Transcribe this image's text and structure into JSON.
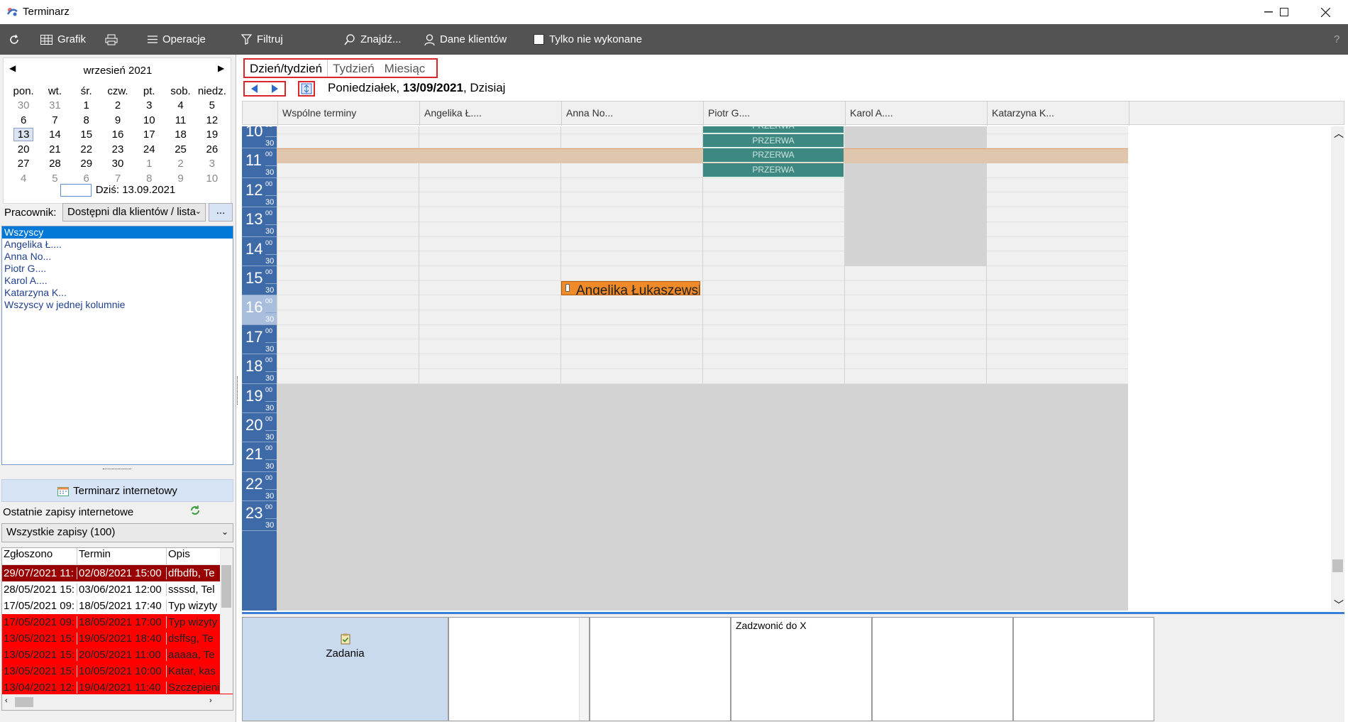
{
  "window": {
    "title": "Terminarz",
    "minimize": "—",
    "maximize": "☐",
    "close": "✕"
  },
  "toolbar": {
    "refresh": "",
    "grafik": "Grafik",
    "print": "",
    "operacje": "Operacje",
    "filtruj": "Filtruj",
    "znajdz": "Znajdź...",
    "dane_klientow": "Dane klientów",
    "tylko_niewykonane": "Tylko nie wykonane",
    "help": "?"
  },
  "calendar": {
    "month_title": "wrzesień 2021",
    "weekdays": [
      "pon.",
      "wt.",
      "śr.",
      "czw.",
      "pt.",
      "sob.",
      "niedz."
    ],
    "weeks": [
      [
        "30",
        "31",
        "1",
        "2",
        "3",
        "4",
        "5"
      ],
      [
        "6",
        "7",
        "8",
        "9",
        "10",
        "11",
        "12"
      ],
      [
        "13",
        "14",
        "15",
        "16",
        "17",
        "18",
        "19"
      ],
      [
        "20",
        "21",
        "22",
        "23",
        "24",
        "25",
        "26"
      ],
      [
        "27",
        "28",
        "29",
        "30",
        "1",
        "2",
        "3"
      ],
      [
        "4",
        "5",
        "6",
        "7",
        "8",
        "9",
        "10"
      ]
    ],
    "selected": "13",
    "today_label": "Dziś: 13.09.2021"
  },
  "employee_filter": {
    "label": "Pracownik:",
    "value": "Dostępni dla klientów / lista",
    "more_button": "..."
  },
  "employee_list": [
    "Wszyscy",
    "Angelika Ł....",
    "Anna No...",
    "Piotr G....",
    "Karol A....",
    "Katarzyna K...",
    "Wszyscy w jednej kolumnie"
  ],
  "internet": {
    "button_label": "Terminarz internetowy",
    "recent_label": "Ostatnie zapisy internetowe",
    "filter_value": "Wszystkie zapisy (100)",
    "columns": [
      "Zgłoszono",
      "Termin",
      "Opis"
    ],
    "rows": [
      {
        "zgloszono": "29/07/2021 11:",
        "termin": "02/08/2021 15:00",
        "opis": "dfbdfb, Te",
        "style": "dark"
      },
      {
        "zgloszono": "28/05/2021 15:",
        "termin": "03/06/2021 12:00",
        "opis": "ssssd, Tel",
        "style": "normal"
      },
      {
        "zgloszono": "17/05/2021 09:",
        "termin": "18/05/2021 17:40",
        "opis": "Typ wizyty",
        "style": "normal"
      },
      {
        "zgloszono": "17/05/2021 09:",
        "termin": "18/05/2021 17:00",
        "opis": "Typ wizyty",
        "style": "red"
      },
      {
        "zgloszono": "13/05/2021 15:",
        "termin": "19/05/2021 18:40",
        "opis": "dsffsg, Te",
        "style": "red"
      },
      {
        "zgloszono": "13/05/2021 15:",
        "termin": "20/05/2021 11:00",
        "opis": "aaaaa, Te",
        "style": "red"
      },
      {
        "zgloszono": "13/05/2021 15:",
        "termin": "10/05/2021 10:00",
        "opis": "Katar, kas",
        "style": "red"
      },
      {
        "zgloszono": "13/04/2021 12:",
        "termin": "19/04/2021 11:40",
        "opis": "Szczepienie",
        "style": "red"
      }
    ]
  },
  "views": {
    "tabs": [
      "Dzień/tydzień",
      "Tydzień",
      "Miesiąc"
    ],
    "active": 0
  },
  "date_header": {
    "weekday": "Poniedziałek,",
    "date": "13/09/2021",
    "suffix": ", Dzisiaj"
  },
  "columns": [
    "Wspólne terminy",
    "Angelika Ł....",
    "Anna No...",
    "Piotr G....",
    "Karol A....",
    "Katarzyna K..."
  ],
  "hours": [
    "10",
    "11",
    "12",
    "13",
    "14",
    "15",
    "16",
    "17",
    "18",
    "19",
    "20",
    "21",
    "22",
    "23"
  ],
  "minute_labels": {
    "top": "00",
    "half": "30"
  },
  "breaks": {
    "label": "PRZERWA",
    "column": "Piotr G....",
    "count": 4
  },
  "appointment": {
    "text": "Angelika Łukaszewsk...",
    "column": "Anna No...",
    "start": "15:30"
  },
  "tasks": {
    "label": "Zadania",
    "items": [
      {
        "column": "Piotr G....",
        "text": "Zadzwonić do X"
      }
    ]
  },
  "colors": {
    "time_column": "#3f6aa8",
    "break": "#3d8880",
    "appointment": "#ee8a2a",
    "current_row": "#dfc6ad",
    "offhours": "#d3d3d3",
    "accent": "#d9262b"
  }
}
